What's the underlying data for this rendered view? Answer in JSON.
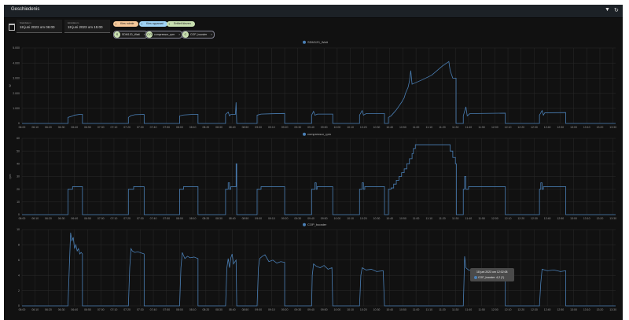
{
  "header": {
    "title": "Geschiedenis",
    "filter_icon": "filter-remove-icon",
    "refresh_icon": "refresh-icon"
  },
  "dates": {
    "start_label": "Startdatum",
    "start_value": "18 juni 2023 om 06:00",
    "end_label": "Einddatum",
    "end_value": "18 juni 2023 om 15:00"
  },
  "targets": {
    "area": "Kies ruimte",
    "device": "Kies apparaat",
    "entity": "Entiteit kiezen"
  },
  "entities": [
    {
      "avatar": "S",
      "label": "SDM120_Watt"
    },
    {
      "avatar": "CO",
      "label": "compressor_rpm"
    },
    {
      "avatar": "C",
      "label": "COP_booster"
    }
  ],
  "colors": {
    "series": "#4a7fb5",
    "grid": "#2a2a2a",
    "background": "#111111"
  },
  "tooltip": {
    "time": "18 juni 2023 om 12:02:08",
    "value": "COP_booster: 4,2 (?)"
  },
  "chart_data": [
    {
      "type": "line",
      "title": "SDM120_Watt",
      "ylabel": "W",
      "ylim": [
        0,
        5000
      ],
      "yticks": [
        "0",
        "1.000",
        "2.000",
        "3.000",
        "4.000",
        "5.000"
      ],
      "x_unit": "minutes since 06:00",
      "xticks": [
        "06:00",
        "06:10",
        "06:20",
        "06:30",
        "06:40",
        "06:50",
        "07:00",
        "07:10",
        "07:20",
        "07:30",
        "07:40",
        "07:50",
        "08:00",
        "08:10",
        "08:20",
        "08:30",
        "08:40",
        "08:50",
        "09:00",
        "09:10",
        "09:20",
        "09:30",
        "09:40",
        "09:50",
        "10:00",
        "10:10",
        "10:20",
        "10:30",
        "10:40",
        "10:50",
        "11:00",
        "11:10",
        "11:20",
        "11:30",
        "11:40",
        "11:50",
        "12:00",
        "12:10",
        "12:20",
        "12:30",
        "12:40",
        "12:50",
        "13:00",
        "13:10",
        "13:20",
        "13:30"
      ],
      "points": [
        [
          0,
          0
        ],
        [
          35,
          0
        ],
        [
          35,
          400
        ],
        [
          38,
          480
        ],
        [
          40,
          550
        ],
        [
          44,
          600
        ],
        [
          46,
          600
        ],
        [
          46,
          0
        ],
        [
          81,
          0
        ],
        [
          81,
          400
        ],
        [
          83,
          520
        ],
        [
          86,
          580
        ],
        [
          93,
          600
        ],
        [
          93,
          0
        ],
        [
          120,
          0
        ],
        [
          120,
          500
        ],
        [
          123,
          560
        ],
        [
          130,
          600
        ],
        [
          134,
          600
        ],
        [
          134,
          0
        ],
        [
          155,
          0
        ],
        [
          155,
          600
        ],
        [
          157,
          750
        ],
        [
          158,
          500
        ],
        [
          159,
          600
        ],
        [
          162.5,
          600
        ],
        [
          163,
          1400
        ],
        [
          163.5,
          0
        ],
        [
          179,
          0
        ],
        [
          179,
          550
        ],
        [
          182,
          620
        ],
        [
          190,
          640
        ],
        [
          200,
          660
        ],
        [
          200,
          0
        ],
        [
          220.5,
          0
        ],
        [
          220.5,
          550
        ],
        [
          222,
          800
        ],
        [
          223,
          550
        ],
        [
          225,
          620
        ],
        [
          236.6,
          620
        ],
        [
          236.6,
          0
        ],
        [
          257,
          0
        ],
        [
          257,
          550
        ],
        [
          259,
          850
        ],
        [
          260,
          550
        ],
        [
          262,
          650
        ],
        [
          276,
          650
        ],
        [
          276,
          0
        ],
        [
          279,
          0
        ],
        [
          279,
          400
        ],
        [
          281,
          500
        ],
        [
          283,
          700
        ],
        [
          285,
          900
        ],
        [
          287,
          1150
        ],
        [
          289,
          1400
        ],
        [
          291,
          1700
        ],
        [
          292,
          2000
        ],
        [
          294,
          2400
        ],
        [
          295,
          2800
        ],
        [
          296,
          3500
        ],
        [
          297,
          2600
        ],
        [
          305,
          2900
        ],
        [
          312,
          3200
        ],
        [
          316,
          3500
        ],
        [
          320,
          3800
        ],
        [
          325,
          4100
        ],
        [
          326,
          3500
        ],
        [
          328,
          3000
        ],
        [
          330.5,
          3000
        ],
        [
          330.5,
          0
        ],
        [
          336,
          0
        ],
        [
          336,
          500
        ],
        [
          338,
          1100
        ],
        [
          339,
          500
        ],
        [
          341,
          650
        ],
        [
          368,
          680
        ],
        [
          368,
          0
        ],
        [
          394,
          0
        ],
        [
          394,
          550
        ],
        [
          396,
          850
        ],
        [
          397,
          550
        ],
        [
          398,
          700
        ],
        [
          414,
          720
        ],
        [
          414,
          0
        ],
        [
          452,
          0
        ]
      ]
    },
    {
      "type": "line",
      "title": "compressor_rpm",
      "ylabel": "rpm",
      "ylim": [
        0,
        60
      ],
      "yticks": [
        "0",
        "10",
        "20",
        "30",
        "40",
        "50",
        "60"
      ],
      "step": true,
      "points": [
        [
          0,
          0
        ],
        [
          35,
          0
        ],
        [
          35,
          20
        ],
        [
          38.5,
          22
        ],
        [
          46,
          22
        ],
        [
          46,
          0
        ],
        [
          81,
          0
        ],
        [
          81,
          20
        ],
        [
          85,
          22
        ],
        [
          93,
          22
        ],
        [
          93,
          0
        ],
        [
          120,
          0
        ],
        [
          120,
          20
        ],
        [
          123,
          22
        ],
        [
          134,
          22
        ],
        [
          134,
          0
        ],
        [
          155,
          0
        ],
        [
          155,
          20
        ],
        [
          157,
          25
        ],
        [
          158,
          20
        ],
        [
          159,
          22
        ],
        [
          163,
          40
        ],
        [
          163.5,
          0
        ],
        [
          179,
          0
        ],
        [
          179,
          20
        ],
        [
          182,
          22
        ],
        [
          200,
          22
        ],
        [
          200,
          0
        ],
        [
          220.5,
          0
        ],
        [
          220.5,
          20
        ],
        [
          223,
          25
        ],
        [
          224,
          20
        ],
        [
          224.7,
          22
        ],
        [
          236.6,
          22
        ],
        [
          236.6,
          0
        ],
        [
          257,
          0
        ],
        [
          257,
          20
        ],
        [
          259,
          25
        ],
        [
          260,
          20
        ],
        [
          261,
          22
        ],
        [
          276,
          22
        ],
        [
          276,
          0
        ],
        [
          279,
          0
        ],
        [
          279,
          20
        ],
        [
          281,
          21
        ],
        [
          283,
          24
        ],
        [
          285,
          27
        ],
        [
          287,
          30
        ],
        [
          289,
          33
        ],
        [
          291,
          36
        ],
        [
          293,
          40
        ],
        [
          295,
          44
        ],
        [
          297,
          48
        ],
        [
          298,
          52
        ],
        [
          299.5,
          55
        ],
        [
          325,
          55
        ],
        [
          326,
          50
        ],
        [
          328,
          45
        ],
        [
          330,
          40
        ],
        [
          330.7,
          0
        ],
        [
          336,
          0
        ],
        [
          336,
          20
        ],
        [
          337,
          30
        ],
        [
          338,
          20
        ],
        [
          340,
          22
        ],
        [
          368,
          22
        ],
        [
          368,
          0
        ],
        [
          394,
          0
        ],
        [
          394,
          20
        ],
        [
          395,
          25
        ],
        [
          396,
          20
        ],
        [
          397,
          22
        ],
        [
          414,
          22
        ],
        [
          414,
          0
        ],
        [
          452,
          0
        ]
      ]
    },
    {
      "type": "line",
      "title": "COP_booster",
      "ylabel": "",
      "ylim": [
        0,
        10
      ],
      "yticks": [
        "0",
        "2",
        "4",
        "6",
        "8",
        "10"
      ],
      "points": [
        [
          0,
          0
        ],
        [
          35,
          0
        ],
        [
          36,
          5
        ],
        [
          37,
          9.6
        ],
        [
          38,
          8.5
        ],
        [
          39,
          9
        ],
        [
          40,
          7.5
        ],
        [
          41,
          8
        ],
        [
          42,
          7.2
        ],
        [
          43,
          7.5
        ],
        [
          44,
          6.8
        ],
        [
          45,
          7
        ],
        [
          46,
          6.8
        ],
        [
          46,
          0
        ],
        [
          81,
          0
        ],
        [
          82,
          5
        ],
        [
          83,
          7.5
        ],
        [
          84,
          7.2
        ],
        [
          86,
          7
        ],
        [
          88,
          7.1
        ],
        [
          93,
          6.8
        ],
        [
          93,
          0
        ],
        [
          120,
          0
        ],
        [
          121,
          5
        ],
        [
          122,
          7
        ],
        [
          124,
          6.2
        ],
        [
          126,
          6.5
        ],
        [
          128,
          6.3
        ],
        [
          131,
          6.4
        ],
        [
          134,
          6.2
        ],
        [
          134,
          0
        ],
        [
          155,
          0
        ],
        [
          156,
          5
        ],
        [
          157,
          6.2
        ],
        [
          158,
          5
        ],
        [
          159,
          6.3
        ],
        [
          160,
          6.8
        ],
        [
          161,
          5.5
        ],
        [
          163,
          6
        ],
        [
          163.5,
          0
        ],
        [
          179,
          0
        ],
        [
          180,
          5
        ],
        [
          181,
          6.2
        ],
        [
          183,
          6.5
        ],
        [
          185,
          6.7
        ],
        [
          188,
          5.8
        ],
        [
          191,
          6
        ],
        [
          194,
          5.6
        ],
        [
          197,
          5.8
        ],
        [
          200,
          5.7
        ],
        [
          200,
          0
        ],
        [
          220.5,
          0
        ],
        [
          221,
          4
        ],
        [
          222,
          5.5
        ],
        [
          224,
          5.2
        ],
        [
          227,
          5
        ],
        [
          230,
          5.3
        ],
        [
          233,
          4.8
        ],
        [
          236,
          5
        ],
        [
          236.6,
          0
        ],
        [
          257,
          0
        ],
        [
          258,
          4
        ],
        [
          259,
          5
        ],
        [
          262,
          4.7
        ],
        [
          266,
          4.8
        ],
        [
          270,
          4.5
        ],
        [
          275,
          4.6
        ],
        [
          276,
          0
        ],
        [
          336,
          0
        ],
        [
          336.5,
          3
        ],
        [
          337,
          6.5
        ],
        [
          338,
          5
        ],
        [
          340,
          4.7
        ],
        [
          345,
          4.5
        ],
        [
          350,
          4.3
        ],
        [
          355,
          4.5
        ],
        [
          360,
          4.4
        ],
        [
          368,
          4.5
        ],
        [
          368,
          0
        ],
        [
          394,
          0
        ],
        [
          395,
          3
        ],
        [
          396,
          4.8
        ],
        [
          400,
          4.6
        ],
        [
          405,
          4.7
        ],
        [
          410,
          4.5
        ],
        [
          414,
          4.6
        ],
        [
          414,
          0
        ],
        [
          452,
          0
        ]
      ]
    }
  ]
}
